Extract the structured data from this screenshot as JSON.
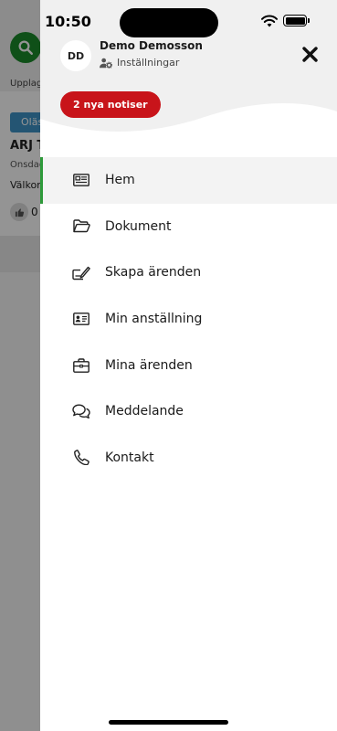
{
  "status_bar": {
    "time": "10:50"
  },
  "background": {
    "uploaded_label": "Upplag",
    "unread_label": "Oläs",
    "post_title": "ARJ T",
    "post_date": "Onsdag",
    "post_text": "Välkon",
    "like_count": "0"
  },
  "drawer": {
    "avatar_initials": "DD",
    "user_name": "Demo Demosson",
    "settings_label": "Inställningar",
    "notifications_badge": "2 nya notiser",
    "menu": [
      {
        "label": "Hem",
        "icon": "newspaper-icon",
        "active": true
      },
      {
        "label": "Dokument",
        "icon": "folder-open-icon",
        "active": false
      },
      {
        "label": "Skapa ärenden",
        "icon": "edit-form-icon",
        "active": false
      },
      {
        "label": "Min anställning",
        "icon": "id-card-icon",
        "active": false
      },
      {
        "label": "Mina ärenden",
        "icon": "briefcase-icon",
        "active": false
      },
      {
        "label": "Meddelande",
        "icon": "chat-bubbles-icon",
        "active": false
      },
      {
        "label": "Kontakt",
        "icon": "phone-icon",
        "active": false
      }
    ]
  },
  "colors": {
    "accent_green": "#2e9a3a",
    "badge_red": "#c8141a",
    "unread_blue": "#3e93c6"
  }
}
